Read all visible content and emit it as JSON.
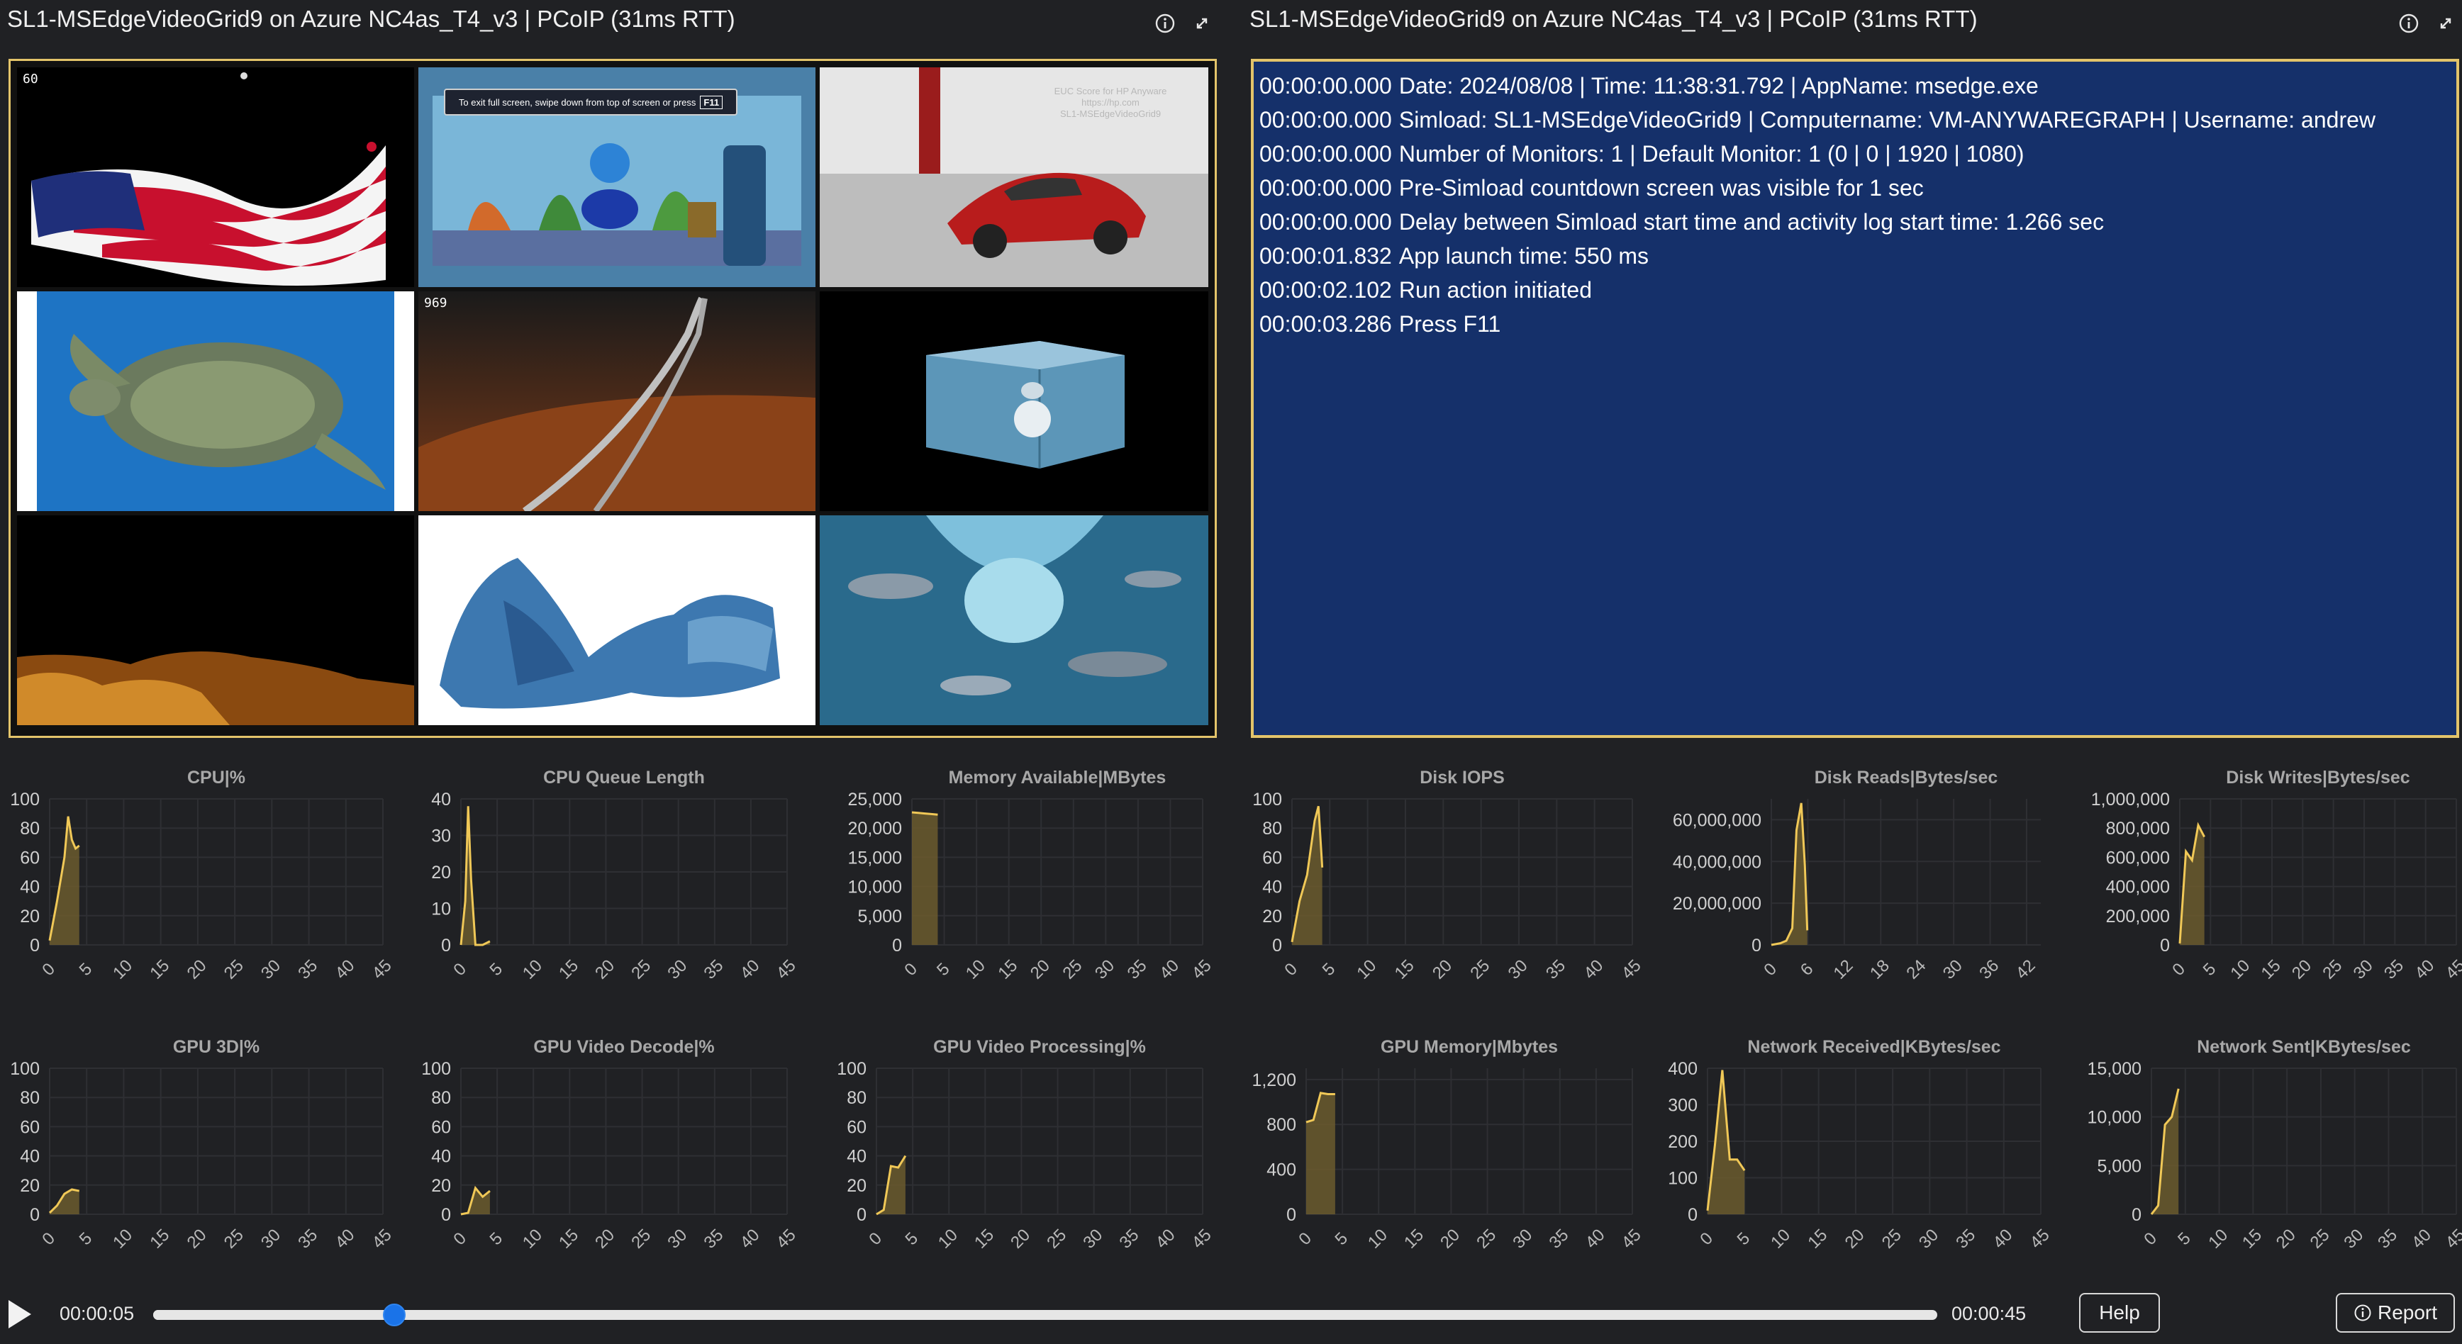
{
  "left_panel": {
    "title": "SL1-MSEdgeVideoGrid9 on Azure NC4as_T4_v3 | PCoIP (31ms RTT)"
  },
  "right_panel": {
    "title": "SL1-MSEdgeVideoGrid9 on Azure NC4as_T4_v3 | PCoIP (31ms RTT)"
  },
  "video": {
    "fps_counter": "60",
    "fish_counter": "969",
    "banner_text": "To exit full screen, swipe down from top of screen or press",
    "banner_key": "F11",
    "overlay_text": [
      "EUC Score for HP Anyware",
      "https://hp.com",
      "SL1-MSEdgeVideoGrid9"
    ]
  },
  "log": [
    {
      "time": "00:00:00.000",
      "text": "Date: 2024/08/08 | Time: 11:38:31.792 | AppName: msedge.exe"
    },
    {
      "time": "00:00:00.000",
      "text": "Simload: SL1-MSEdgeVideoGrid9 | Computername: VM-ANYWAREGRAPH | Username: andrew"
    },
    {
      "time": "00:00:00.000",
      "text": "Number of Monitors: 1 | Default Monitor: 1 (0 | 0 | 1920 | 1080)"
    },
    {
      "time": "00:00:00.000",
      "text": "Pre-Simload countdown screen was visible for 1 sec"
    },
    {
      "time": "00:00:00.000",
      "text": "Delay between Simload start time and activity log start time: 1.266 sec"
    },
    {
      "time": "00:00:01.832",
      "text": "App launch time: 550 ms"
    },
    {
      "time": "00:00:02.102",
      "text": "Run action initiated"
    },
    {
      "time": "00:00:03.286",
      "text": "Press F11"
    }
  ],
  "colors": {
    "accent": "#e3c46a",
    "series": "#f0c857",
    "log_bg": "#15306a",
    "slider_thumb": "#1a73e8"
  },
  "chart_data": [
    {
      "type": "area",
      "title": "CPU|%",
      "ylim": [
        0,
        100
      ],
      "yticks": [
        "0",
        "20",
        "40",
        "60",
        "80",
        "100"
      ],
      "xticks": [
        "0",
        "5",
        "10",
        "15",
        "20",
        "25",
        "30",
        "35",
        "40",
        "45"
      ],
      "xlim": [
        0,
        45
      ],
      "x": [
        0,
        1,
        2,
        2.5,
        3,
        3.5,
        4
      ],
      "y": [
        3,
        30,
        60,
        88,
        72,
        66,
        68
      ]
    },
    {
      "type": "area",
      "title": "CPU Queue Length",
      "ylim": [
        0,
        40
      ],
      "yticks": [
        "0",
        "10",
        "20",
        "30",
        "40"
      ],
      "xticks": [
        "0",
        "5",
        "10",
        "15",
        "20",
        "25",
        "30",
        "35",
        "40",
        "45"
      ],
      "xlim": [
        0,
        45
      ],
      "x": [
        0,
        0.6,
        1,
        1.4,
        2,
        3,
        4
      ],
      "y": [
        0,
        12,
        38,
        18,
        0,
        0,
        1
      ]
    },
    {
      "type": "area",
      "title": "Memory Available|MBytes",
      "ylim": [
        0,
        25000
      ],
      "yticks": [
        "0",
        "5,000",
        "10,000",
        "15,000",
        "20,000",
        "25,000"
      ],
      "xticks": [
        "0",
        "5",
        "10",
        "15",
        "20",
        "25",
        "30",
        "35",
        "40",
        "45"
      ],
      "xlim": [
        0,
        45
      ],
      "x": [
        0,
        1,
        2,
        3,
        4
      ],
      "y": [
        22700,
        22600,
        22500,
        22400,
        22300
      ]
    },
    {
      "type": "area",
      "title": "Disk IOPS",
      "ylim": [
        0,
        100
      ],
      "yticks": [
        "0",
        "20",
        "40",
        "60",
        "80",
        "100"
      ],
      "xticks": [
        "0",
        "5",
        "10",
        "15",
        "20",
        "25",
        "30",
        "35",
        "40",
        "45"
      ],
      "xlim": [
        0,
        45
      ],
      "x": [
        0,
        1,
        2,
        3,
        3.5,
        4
      ],
      "y": [
        2,
        30,
        48,
        85,
        95,
        53
      ]
    },
    {
      "type": "area",
      "title": "Disk Reads|Bytes/sec",
      "ylim": [
        0,
        70000000
      ],
      "yticks": [
        "0",
        "20,000,000",
        "40,000,000",
        "60,000,000"
      ],
      "xticks": [
        "0",
        "6",
        "12",
        "18",
        "24",
        "30",
        "36",
        "42"
      ],
      "xlim": [
        0,
        45
      ],
      "x": [
        0,
        1.5,
        2.5,
        3.5,
        4.2,
        5,
        5.6,
        6
      ],
      "y": [
        0,
        800000,
        2000000,
        8000000,
        55000000,
        68000000,
        38000000,
        7000000
      ]
    },
    {
      "type": "area",
      "title": "Disk Writes|Bytes/sec",
      "ylim": [
        0,
        1000000
      ],
      "yticks": [
        "0",
        "200,000",
        "400,000",
        "600,000",
        "800,000",
        "1,000,000"
      ],
      "xticks": [
        "0",
        "5",
        "10",
        "15",
        "20",
        "25",
        "30",
        "35",
        "40",
        "45"
      ],
      "xlim": [
        0,
        45
      ],
      "x": [
        0,
        1,
        2,
        3,
        3.5,
        4
      ],
      "y": [
        10000,
        640000,
        580000,
        820000,
        780000,
        740000
      ]
    },
    {
      "type": "area",
      "title": "GPU 3D|%",
      "ylim": [
        0,
        100
      ],
      "yticks": [
        "0",
        "20",
        "40",
        "60",
        "80",
        "100"
      ],
      "xticks": [
        "0",
        "5",
        "10",
        "15",
        "20",
        "25",
        "30",
        "35",
        "40",
        "45"
      ],
      "xlim": [
        0,
        45
      ],
      "x": [
        0,
        1,
        2,
        3,
        4
      ],
      "y": [
        1,
        6,
        14,
        17,
        16
      ]
    },
    {
      "type": "area",
      "title": "GPU Video Decode|%",
      "ylim": [
        0,
        100
      ],
      "yticks": [
        "0",
        "20",
        "40",
        "60",
        "80",
        "100"
      ],
      "xticks": [
        "0",
        "5",
        "10",
        "15",
        "20",
        "25",
        "30",
        "35",
        "40",
        "45"
      ],
      "xlim": [
        0,
        45
      ],
      "x": [
        0,
        1,
        2,
        3,
        4
      ],
      "y": [
        0,
        1,
        18,
        12,
        16
      ]
    },
    {
      "type": "area",
      "title": "GPU Video Processing|%",
      "ylim": [
        0,
        100
      ],
      "yticks": [
        "0",
        "20",
        "40",
        "60",
        "80",
        "100"
      ],
      "xticks": [
        "0",
        "5",
        "10",
        "15",
        "20",
        "25",
        "30",
        "35",
        "40",
        "45"
      ],
      "xlim": [
        0,
        45
      ],
      "x": [
        0,
        1,
        2,
        3,
        4
      ],
      "y": [
        0,
        3,
        33,
        32,
        40
      ]
    },
    {
      "type": "area",
      "title": "GPU Memory|Mbytes",
      "ylim": [
        0,
        1300
      ],
      "yticks": [
        "0",
        "400",
        "800",
        "1,200"
      ],
      "xticks": [
        "0",
        "5",
        "10",
        "15",
        "20",
        "25",
        "30",
        "35",
        "40",
        "45"
      ],
      "xlim": [
        0,
        45
      ],
      "x": [
        0,
        1,
        2,
        3,
        4
      ],
      "y": [
        820,
        840,
        1080,
        1070,
        1070
      ]
    },
    {
      "type": "area",
      "title": "Network Received|KBytes/sec",
      "ylim": [
        0,
        400
      ],
      "yticks": [
        "0",
        "100",
        "200",
        "300",
        "400"
      ],
      "xticks": [
        "0",
        "5",
        "10",
        "15",
        "20",
        "25",
        "30",
        "35",
        "40",
        "45"
      ],
      "xlim": [
        0,
        45
      ],
      "x": [
        0,
        1,
        2,
        3,
        4,
        5
      ],
      "y": [
        10,
        190,
        395,
        150,
        150,
        120
      ]
    },
    {
      "type": "area",
      "title": "Network Sent|KBytes/sec",
      "ylim": [
        0,
        15000
      ],
      "yticks": [
        "0",
        "5,000",
        "10,000",
        "15,000"
      ],
      "xticks": [
        "0",
        "5",
        "10",
        "15",
        "20",
        "25",
        "30",
        "35",
        "40",
        "45"
      ],
      "xlim": [
        0,
        45
      ],
      "x": [
        0,
        1,
        2,
        3,
        4
      ],
      "y": [
        0,
        900,
        9200,
        10000,
        12900
      ]
    }
  ],
  "playback": {
    "current_time": "00:00:05",
    "total_time": "00:00:45",
    "progress": 0.135
  },
  "buttons": {
    "help": "Help",
    "report": "Report"
  }
}
